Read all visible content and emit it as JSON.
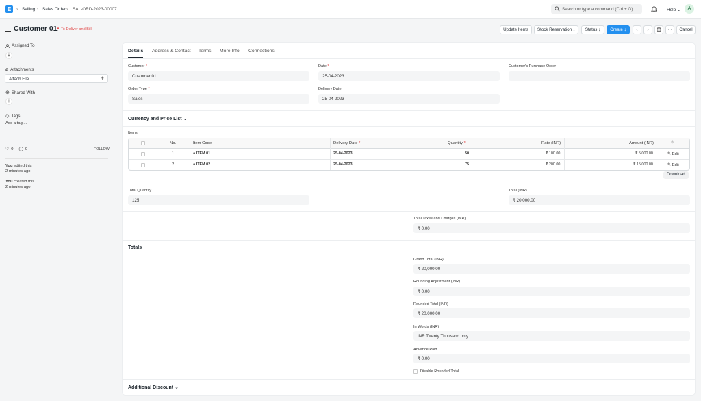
{
  "app": {
    "logo": "E",
    "search_placeholder": "Search or type a command (Ctrl + G)",
    "help": "Help",
    "avatar": "A"
  },
  "breadcrumb": [
    "Selling",
    "Sales Order",
    "SAL-ORD-2023-00007"
  ],
  "header": {
    "title": "Customer 01",
    "status": "To Deliver and Bill"
  },
  "actions": {
    "update_items": "Update Items",
    "stock_reservation": "Stock Reservation",
    "status": "Status",
    "create": "Create",
    "cancel": "Cancel"
  },
  "sidebar": {
    "assigned_to": "Assigned To",
    "attachments": "Attachments",
    "attach_file": "Attach File",
    "shared_with": "Shared With",
    "tags": "Tags",
    "add_tag": "Add a tag ...",
    "likes": "0",
    "comments": "0",
    "follow": "FOLLOW",
    "activity": [
      {
        "who": "You",
        "what": " edited this",
        "when": "2 minutes ago"
      },
      {
        "who": "You",
        "what": " created this",
        "when": "2 minutes ago"
      }
    ]
  },
  "tabs": [
    "Details",
    "Address & Contact",
    "Terms",
    "More Info",
    "Connections"
  ],
  "fields": {
    "customer_label": "Customer",
    "customer": "Customer 01",
    "order_type_label": "Order Type",
    "order_type": "Sales",
    "date_label": "Date",
    "date": "25-04-2023",
    "delivery_date_label": "Delivery Date",
    "delivery_date": "25-04-2023",
    "po_label": "Customer's Purchase Order",
    "po": ""
  },
  "currency_section": "Currency and Price List",
  "items": {
    "label": "Items",
    "headers": {
      "no": "No.",
      "item_code": "Item Code",
      "delivery": "Delivery Date",
      "qty": "Quantity",
      "rate": "Rate (INR)",
      "amount": "Amount (INR)"
    },
    "rows": [
      {
        "no": "1",
        "item": "ITEM 01",
        "date": "25-04-2023",
        "qty": "50",
        "rate": "₹ 100.00",
        "amount": "₹ 5,000.00",
        "edit": "Edit"
      },
      {
        "no": "2",
        "item": "ITEM 02",
        "date": "25-04-2023",
        "qty": "75",
        "rate": "₹ 200.00",
        "amount": "₹ 15,000.00",
        "edit": "Edit"
      }
    ],
    "download": "Download"
  },
  "totals": {
    "total_qty_label": "Total Quantity",
    "total_qty": "125",
    "total_label": "Total (INR)",
    "total": "₹ 20,000.00",
    "taxes_label": "Total Taxes and Charges (INR)",
    "taxes": "₹ 0.00"
  },
  "totals_section": "Totals",
  "summary": {
    "grand_label": "Grand Total (INR)",
    "grand": "₹ 20,000.00",
    "round_adj_label": "Rounding Adjustment (INR)",
    "round_adj": "₹ 0.00",
    "rounded_label": "Rounded Total (INR)",
    "rounded": "₹ 20,000.00",
    "words_label": "In Words (INR)",
    "words": "INR Twenty Thousand only.",
    "advance_label": "Advance Paid",
    "advance": "₹ 0.00",
    "disable_rounded": "Disable Rounded Total"
  },
  "additional_discount": "Additional Discount"
}
